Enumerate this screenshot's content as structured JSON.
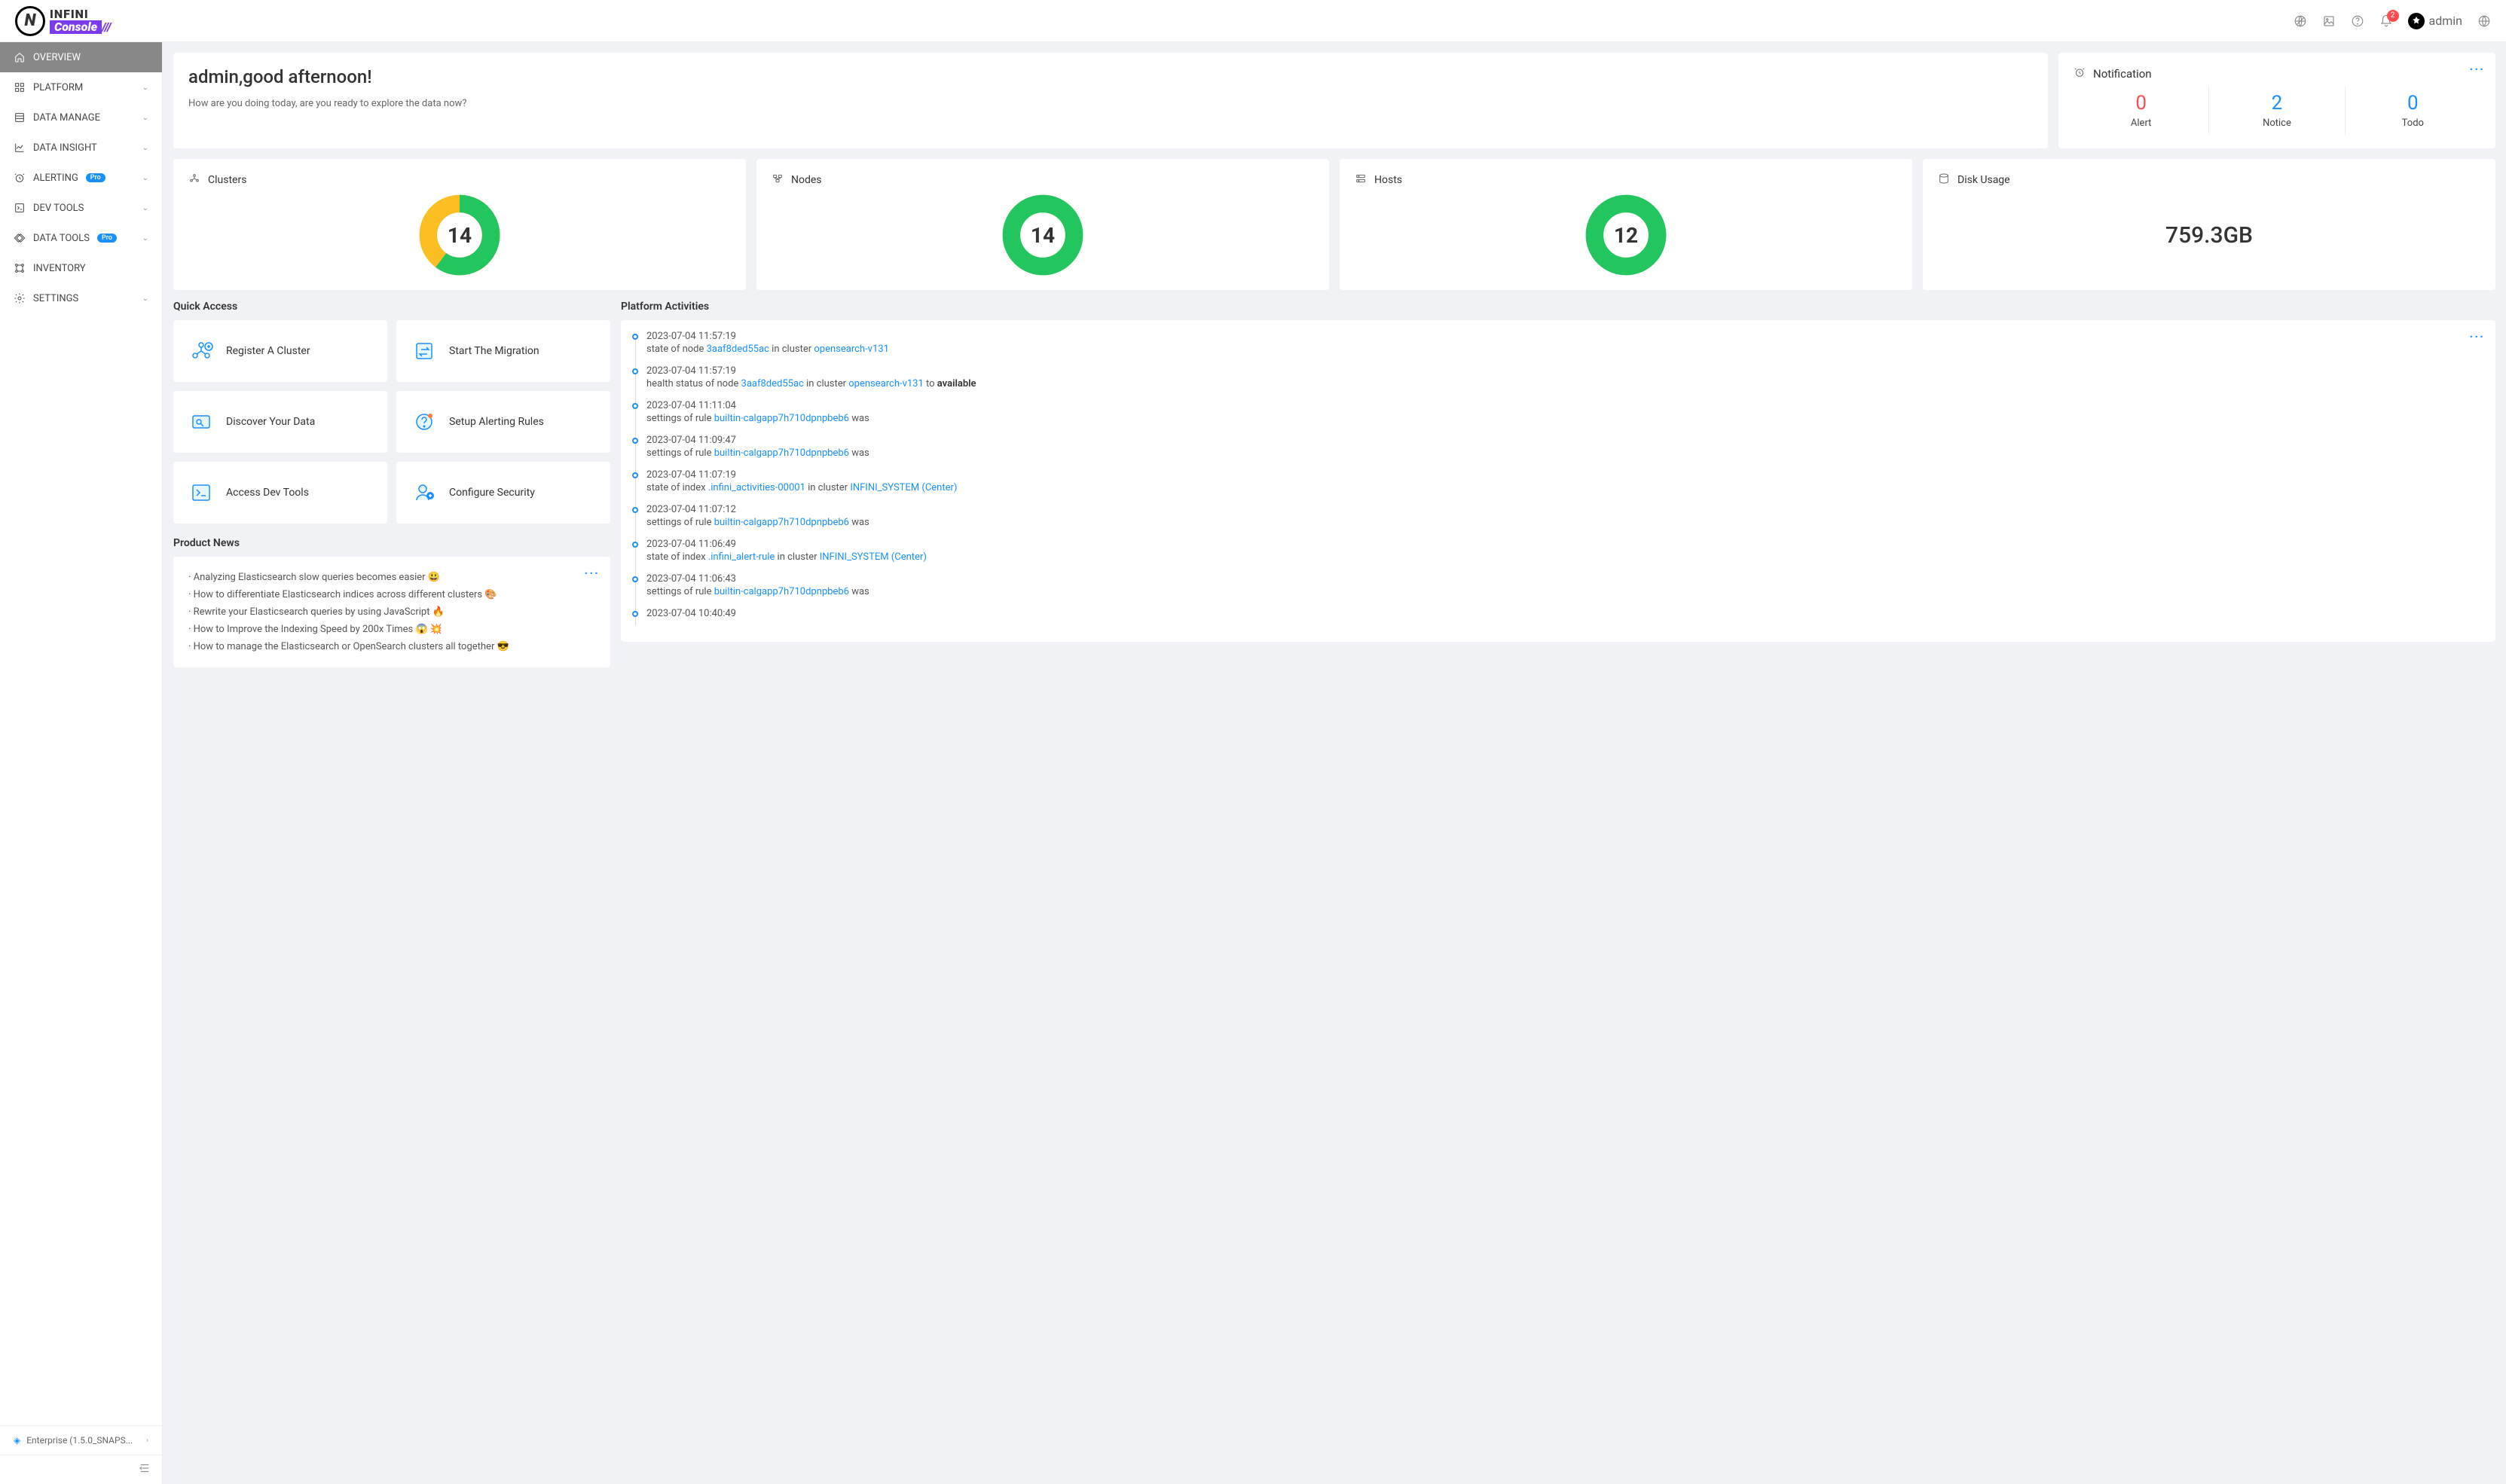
{
  "brand": {
    "line1": "INFINI",
    "line2": "Console",
    "mark": "N"
  },
  "topbar": {
    "notif_count": "2",
    "username": "admin"
  },
  "sidebar": {
    "items": [
      {
        "label": "OVERVIEW",
        "active": true,
        "expandable": false
      },
      {
        "label": "PLATFORM",
        "active": false,
        "expandable": true
      },
      {
        "label": "DATA MANAGE",
        "active": false,
        "expandable": true
      },
      {
        "label": "DATA INSIGHT",
        "active": false,
        "expandable": true
      },
      {
        "label": "ALERTING",
        "active": false,
        "expandable": true,
        "pro": true
      },
      {
        "label": "DEV TOOLS",
        "active": false,
        "expandable": true
      },
      {
        "label": "DATA TOOLS",
        "active": false,
        "expandable": true,
        "pro": true
      },
      {
        "label": "INVENTORY",
        "active": false,
        "expandable": false
      },
      {
        "label": "SETTINGS",
        "active": false,
        "expandable": true
      }
    ],
    "pro_label": "Pro",
    "footer": "Enterprise (1.5.0_SNAPS..."
  },
  "greeting": {
    "title": "admin,good afternoon!",
    "subtitle": "How are you doing today, are you ready to explore the data now?"
  },
  "notification": {
    "title": "Notification",
    "stats": [
      {
        "value": "0",
        "label": "Alert",
        "color": "red"
      },
      {
        "value": "2",
        "label": "Notice",
        "color": "blue"
      },
      {
        "value": "0",
        "label": "Todo",
        "color": "blue"
      }
    ]
  },
  "metrics": {
    "clusters": {
      "title": "Clusters",
      "value": "14",
      "green_pct": 60
    },
    "nodes": {
      "title": "Nodes",
      "value": "14",
      "green_pct": 100
    },
    "hosts": {
      "title": "Hosts",
      "value": "12",
      "green_pct": 100
    },
    "disk": {
      "title": "Disk Usage",
      "value": "759.3GB"
    }
  },
  "quick_access": {
    "title": "Quick Access",
    "items": [
      {
        "label": "Register A Cluster"
      },
      {
        "label": "Start The Migration"
      },
      {
        "label": "Discover Your Data"
      },
      {
        "label": "Setup Alerting Rules"
      },
      {
        "label": "Access Dev Tools"
      },
      {
        "label": "Configure Security"
      }
    ]
  },
  "product_news": {
    "title": "Product News",
    "items": [
      "· Analyzing Elasticsearch slow queries becomes easier 😃",
      "· How to differentiate Elasticsearch indices across different clusters 🎨",
      "· Rewrite your Elasticsearch queries by using JavaScript 🔥",
      "· How to Improve the Indexing Speed by 200x Times 😱 💥",
      "· How to manage the Elasticsearch or OpenSearch clusters all together 😎"
    ]
  },
  "activities": {
    "title": "Platform Activities",
    "items": [
      {
        "time": "2023-07-04 11:57:19",
        "prefix": "state of node ",
        "link1": "3aaf8ded55ac",
        "mid": " in cluster ",
        "link2": "opensearch-v131",
        "suffix": ""
      },
      {
        "time": "2023-07-04 11:57:19",
        "prefix": "health status of node ",
        "link1": "3aaf8ded55ac",
        "mid": " in cluster ",
        "link2": "opensearch-v131",
        "suffix": " to ",
        "bold": "available"
      },
      {
        "time": "2023-07-04 11:11:04",
        "prefix": "settings of rule ",
        "link1": "builtin-calgapp7h710dpnpbeb6",
        "mid": "",
        "link2": "",
        "suffix": " was"
      },
      {
        "time": "2023-07-04 11:09:47",
        "prefix": "settings of rule ",
        "link1": "builtin-calgapp7h710dpnpbeb6",
        "mid": "",
        "link2": "",
        "suffix": " was"
      },
      {
        "time": "2023-07-04 11:07:19",
        "prefix": "state of index ",
        "link1": ".infini_activities-00001",
        "mid": " in cluster ",
        "link2": "INFINI_SYSTEM (Center)",
        "suffix": ""
      },
      {
        "time": "2023-07-04 11:07:12",
        "prefix": "settings of rule ",
        "link1": "builtin-calgapp7h710dpnpbeb6",
        "mid": "",
        "link2": "",
        "suffix": " was"
      },
      {
        "time": "2023-07-04 11:06:49",
        "prefix": "state of index ",
        "link1": ".infini_alert-rule",
        "mid": " in cluster ",
        "link2": "INFINI_SYSTEM (Center)",
        "suffix": ""
      },
      {
        "time": "2023-07-04 11:06:43",
        "prefix": "settings of rule ",
        "link1": "builtin-calgapp7h710dpnpbeb6",
        "mid": "",
        "link2": "",
        "suffix": " was"
      },
      {
        "time": "2023-07-04 10:40:49",
        "prefix": "",
        "link1": "",
        "mid": "",
        "link2": "",
        "suffix": ""
      }
    ]
  }
}
